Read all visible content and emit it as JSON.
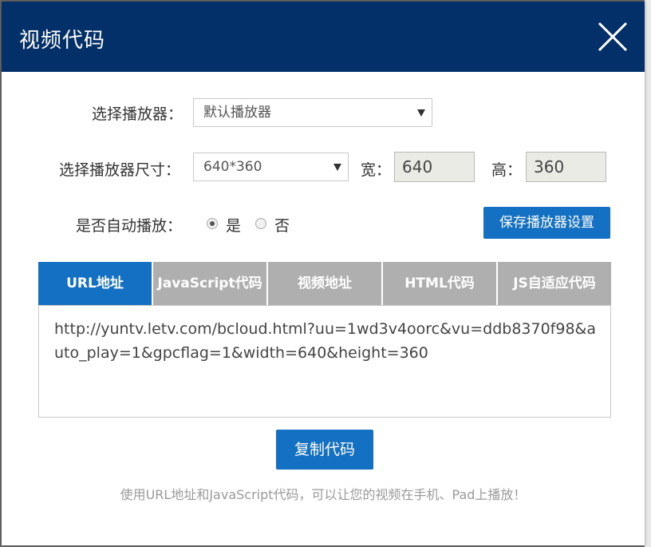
{
  "modal": {
    "title": "视频代码"
  },
  "form": {
    "player_label": "选择播放器：",
    "player_selected": "默认播放器",
    "size_label": "选择播放器尺寸：",
    "size_selected": "640*360",
    "width_label": "宽：",
    "width_value": "640",
    "height_label": "高：",
    "height_value": "360",
    "autoplay_label": "是否自动播放：",
    "autoplay_yes": "是",
    "autoplay_no": "否",
    "autoplay_selected": "是",
    "save_button": "保存播放器设置"
  },
  "tabs": [
    {
      "label": "URL地址",
      "active": true
    },
    {
      "label": "JavaScript代码",
      "active": false
    },
    {
      "label": "视频地址",
      "active": false
    },
    {
      "label": "HTML代码",
      "active": false
    },
    {
      "label": "JS自适应代码",
      "active": false
    }
  ],
  "code": {
    "text": "http://yuntv.letv.com/bcloud.html?uu=1wd3v4oorc&vu=ddb8370f98&auto_play=1&gpcflag=1&width=640&height=360"
  },
  "copy_button": "复制代码",
  "hint": "使用URL地址和JavaScript代码，可以让您的视频在手机、Pad上播放！",
  "colors": {
    "header_bg": "#04306a",
    "accent": "#1470c3",
    "tab_inactive": "#afafaf"
  },
  "icons": {
    "close": "close-icon",
    "dropdown": "chevron-down-icon"
  }
}
